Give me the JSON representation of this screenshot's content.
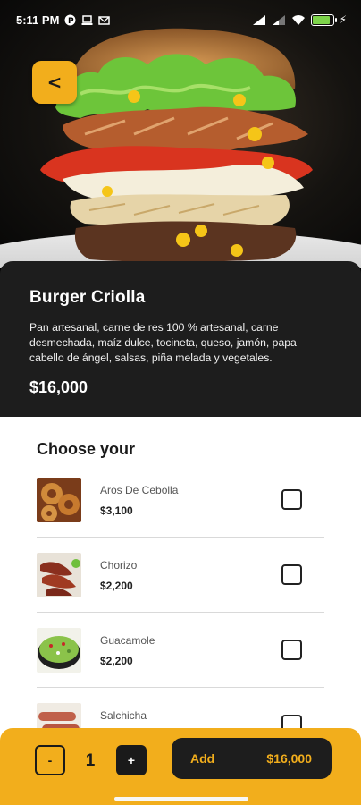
{
  "status_bar": {
    "time": "5:11 PM",
    "left_icons": [
      "circle-p-icon",
      "laptop-icon",
      "mail-icon"
    ],
    "right_icons": [
      "signal-icon",
      "signal-icon",
      "wifi-icon",
      "battery-icon",
      "charging-icon"
    ],
    "battery_level": 0.9
  },
  "hero": {
    "image": "burger-photo",
    "back_label": "<"
  },
  "product": {
    "title": "Burger Criolla",
    "description": "Pan artesanal, carne de res 100 % artesanal, carne desmechada, maíz dulce, tocineta, queso, jamón, papa cabello de ángel, salsas, piña melada y vegetales.",
    "price": "$16,000"
  },
  "options": {
    "heading": "Choose your",
    "items": [
      {
        "name": "Aros De Cebolla",
        "price": "$3,100",
        "image": "onion-rings-photo",
        "checked": false
      },
      {
        "name": "Chorizo",
        "price": "$2,200",
        "image": "chorizo-photo",
        "checked": false
      },
      {
        "name": "Guacamole",
        "price": "$2,200",
        "image": "guacamole-photo",
        "checked": false
      },
      {
        "name": "Salchicha",
        "price": "",
        "image": "sausage-photo",
        "checked": false
      }
    ]
  },
  "cart": {
    "minus_label": "-",
    "quantity": "1",
    "plus_label": "+",
    "add_label": "Add",
    "total": "$16,000"
  },
  "colors": {
    "accent": "#f2ae1c",
    "dark": "#1d1d1d",
    "white": "#ffffff"
  }
}
